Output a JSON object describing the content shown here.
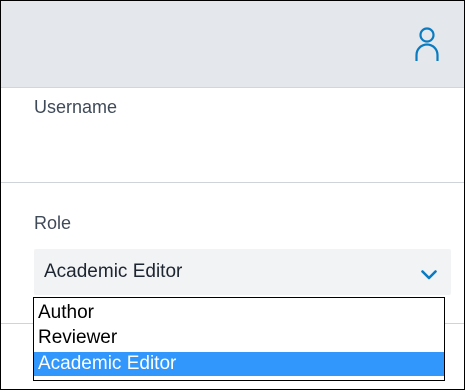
{
  "header": {
    "user_icon": "user-icon"
  },
  "form": {
    "username_label": "Username",
    "role_label": "Role",
    "role_select": {
      "selected_value": "Academic Editor",
      "dropdown_icon": "chevron-down-icon",
      "options": [
        "Author",
        "Reviewer",
        "Academic Editor"
      ],
      "highlighted_option": "Academic Editor"
    }
  },
  "colors": {
    "top_bar_background": "#e4e7ec",
    "accent": "#0a7bc0",
    "highlight": "#3197fc",
    "field_background": "#f2f3f5",
    "label_text": "#3f4a59"
  }
}
